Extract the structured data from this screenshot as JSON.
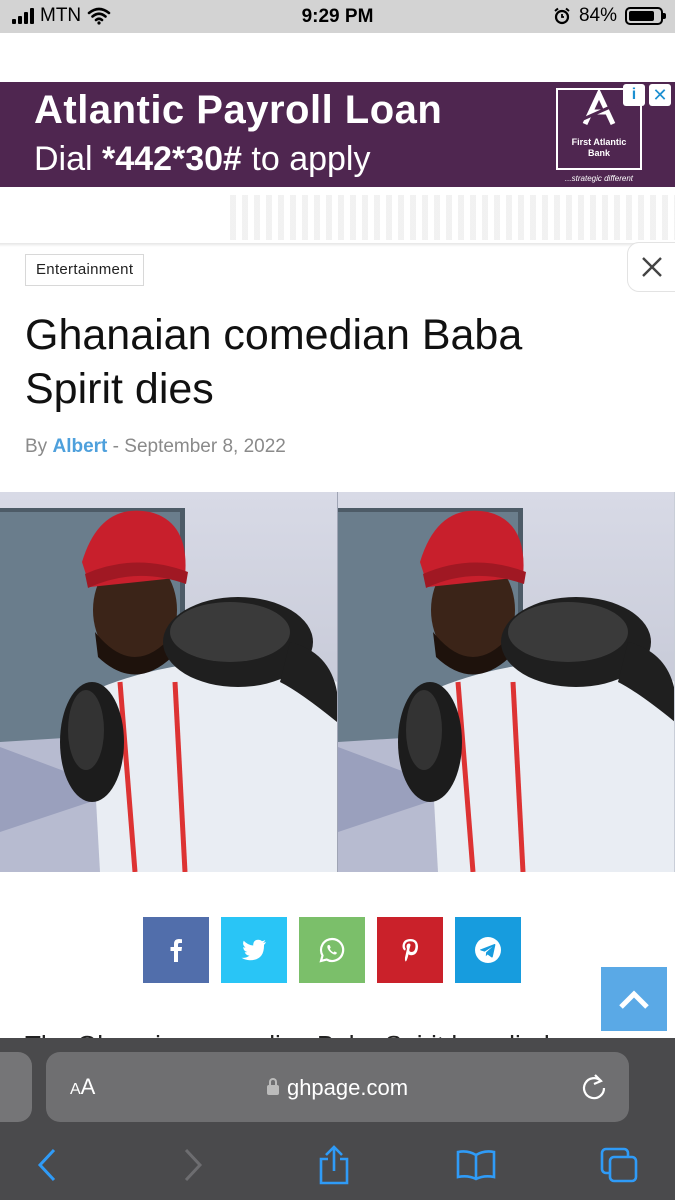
{
  "status_bar": {
    "carrier": "MTN",
    "time": "9:29 PM",
    "battery": "84%",
    "battery_level": 0.84
  },
  "ad": {
    "title": "Atlantic Payroll Loan",
    "line_prefix": "Dial ",
    "code": "*442*30#",
    "line_suffix": " to apply",
    "logo_name": "First Atlantic Bank",
    "logo_tagline": "...strategic different",
    "colors": {
      "background": "#4f2650",
      "text": "#ffffff"
    }
  },
  "article": {
    "category": "Entertainment",
    "headline": "Ghanaian comedian Baba Spirit dies",
    "by_label": "By",
    "author": "Albert",
    "separator": "-",
    "date": "September 8, 2022",
    "body_peek": "The Ghanaian comedian Baba Spirit has died"
  },
  "share": [
    {
      "network": "facebook",
      "icon": "facebook-icon",
      "color": "#516eab"
    },
    {
      "network": "twitter",
      "icon": "twitter-icon",
      "color": "#29c5f6"
    },
    {
      "network": "whatsapp",
      "icon": "whatsapp-icon",
      "color": "#7bbf6a"
    },
    {
      "network": "pinterest",
      "icon": "pinterest-icon",
      "color": "#ca212a"
    },
    {
      "network": "telegram",
      "icon": "telegram-icon",
      "color": "#179cde"
    }
  ],
  "browser": {
    "text_size_label": "AA",
    "domain": "ghpage.com"
  },
  "colors": {
    "author_link": "#4ea0dc",
    "back_to_top": "#5aa9e6",
    "safari_bar": "#4a4a4c"
  }
}
